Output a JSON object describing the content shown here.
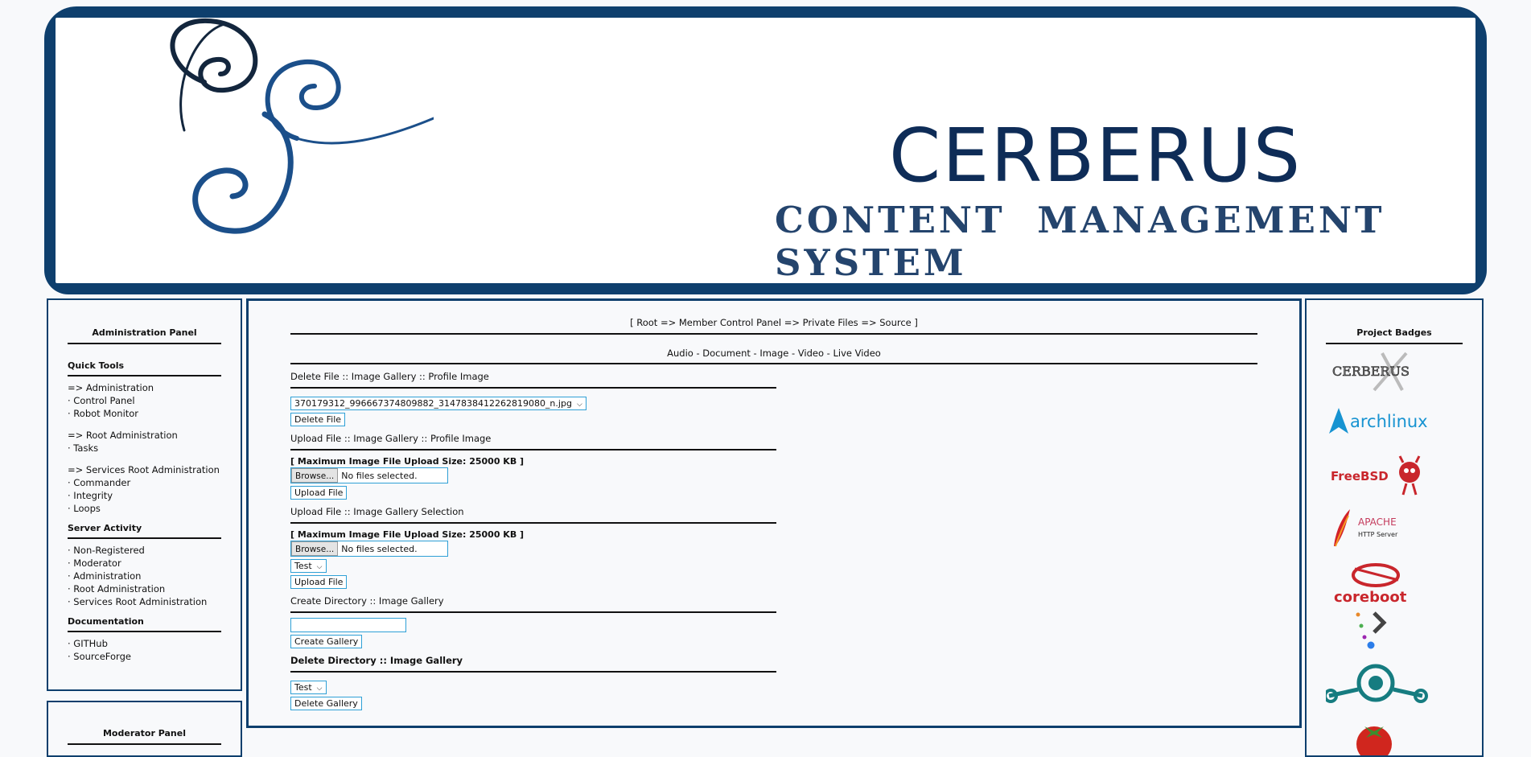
{
  "banner": {
    "title": "CERBERUS",
    "subtitle": "CONTENT MANAGEMENT SYSTEM",
    "colors": {
      "frame": "#0e3f6d",
      "title": "#0e2c57"
    }
  },
  "left_panel": {
    "title": "Administration Panel",
    "sections": [
      {
        "heading": "Quick Tools",
        "groups": [
          [
            "=> Administration",
            "· Control Panel",
            "· Robot Monitor"
          ],
          [
            "=> Root Administration",
            "· Tasks"
          ],
          [
            "=> Services Root Administration",
            "· Commander",
            "· Integrity",
            "· Loops"
          ]
        ]
      },
      {
        "heading": "Server Activity",
        "groups": [
          [
            "· Non-Registered",
            "· Moderator",
            "· Administration",
            "· Root Administration",
            "· Services Root Administration"
          ]
        ]
      },
      {
        "heading": "Documentation",
        "groups": [
          [
            "· GITHub",
            "· SourceForge"
          ]
        ]
      }
    ]
  },
  "left_panel2": {
    "title": "Moderator Panel"
  },
  "main": {
    "breadcrumb": "[ Root => Member Control Panel => Private Files => Source ]",
    "media_tabs": "Audio - Document - Image - Video - Live Video",
    "delete_file": {
      "heading": "Delete File :: Image Gallery :: Profile Image",
      "selected": "370179312_996667374809882_3147838412262819080_n.jpg",
      "button": "Delete File"
    },
    "upload_profile": {
      "heading": "Upload File :: Image Gallery :: Profile Image",
      "note": "[ Maximum Image File Upload Size: 25000 KB ]",
      "browse": "Browse...",
      "no_files": "No files selected.",
      "button": "Upload File"
    },
    "upload_selection": {
      "heading": "Upload File :: Image Gallery Selection",
      "note": "[ Maximum Image File Upload Size: 25000 KB ]",
      "browse": "Browse...",
      "no_files": "No files selected.",
      "gallery": "Test",
      "button": "Upload File"
    },
    "create_dir": {
      "heading": "Create Directory :: Image Gallery",
      "value": "",
      "button": "Create Gallery"
    },
    "delete_dir": {
      "heading": "Delete Directory :: Image Gallery",
      "gallery": "Test",
      "button": "Delete Gallery"
    }
  },
  "right_panel": {
    "title": "Project Badges",
    "badges": [
      {
        "name": "cerberus",
        "text": "CERBERUS"
      },
      {
        "name": "archlinux",
        "text": "archlinux"
      },
      {
        "name": "freebsd",
        "text": "FreeBSD"
      },
      {
        "name": "apache",
        "text": "APACHE",
        "sub": "HTTP Server"
      },
      {
        "name": "coreboot",
        "text": "coreboot"
      },
      {
        "name": "dots",
        "text": ""
      },
      {
        "name": "lineage",
        "text": ""
      },
      {
        "name": "tomato",
        "text": ""
      }
    ]
  }
}
